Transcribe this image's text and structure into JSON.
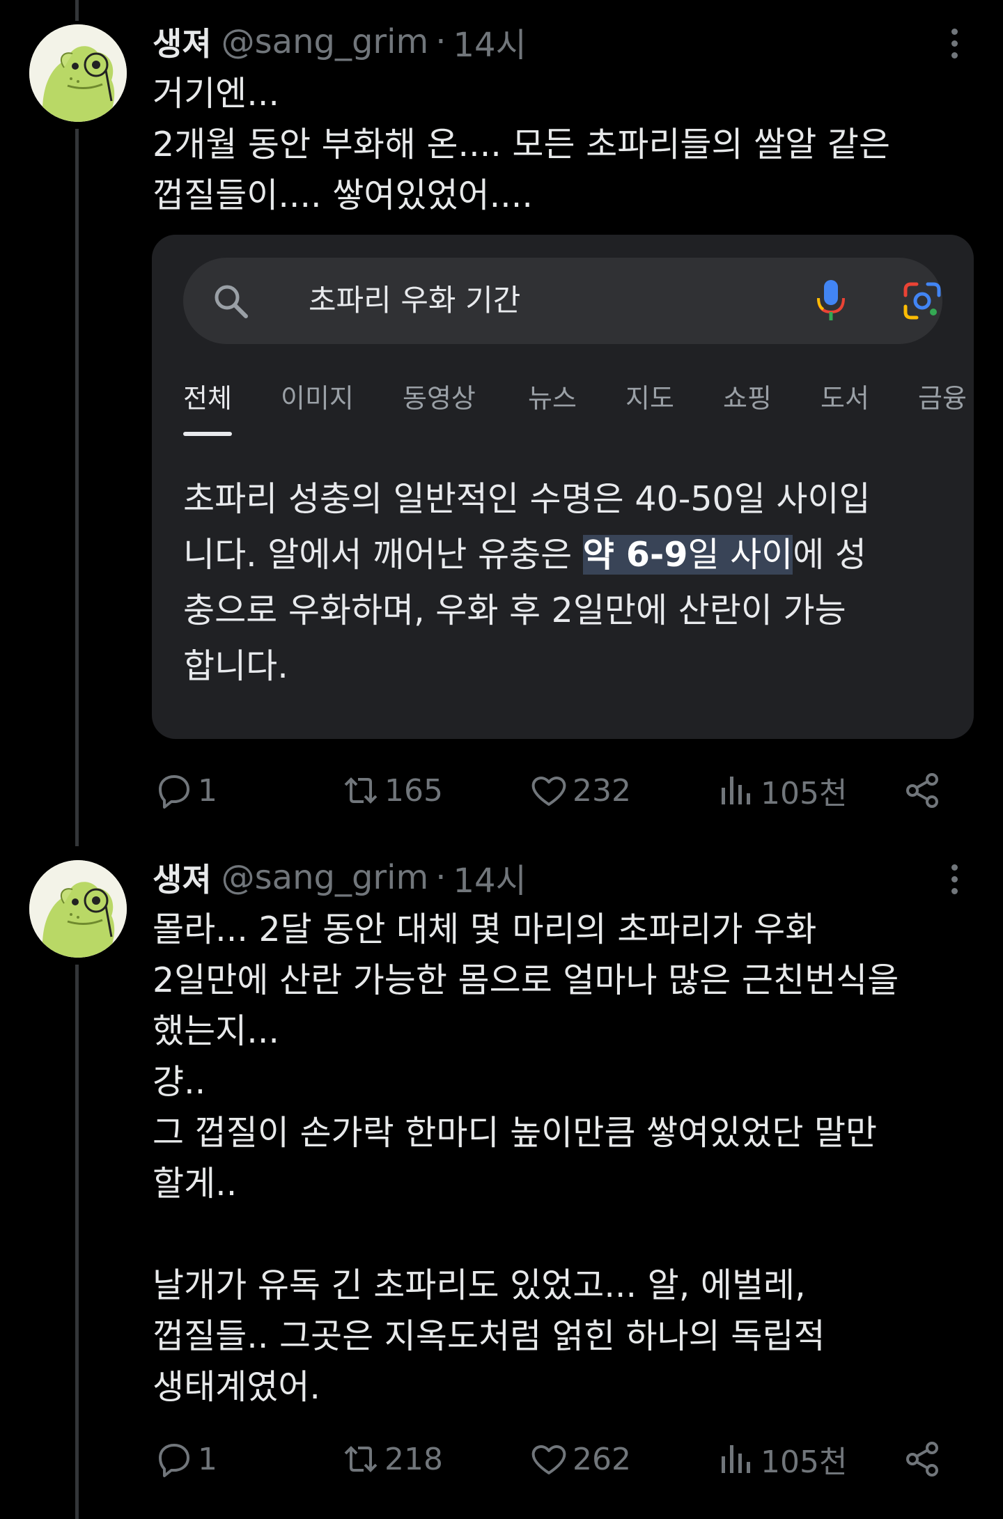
{
  "tweets": [
    {
      "display_name": "생져",
      "handle": "@sang_grim",
      "separator": "·",
      "time": "14시",
      "text_lines": [
        "거기엔...",
        "2개월 동안 부화해 온.... 모든 초파리들의 쌀알 같은",
        "껍질들이.... 쌓여있었어...."
      ],
      "stats": {
        "replies": "1",
        "retweets": "165",
        "likes": "232",
        "views": "105천"
      }
    },
    {
      "display_name": "생져",
      "handle": "@sang_grim",
      "separator": "·",
      "time": "14시",
      "text_lines": [
        "몰라... 2달 동안 대체 몇 마리의 초파리가 우화",
        "2일만에 산란 가능한 몸으로 얼마나 많은 근친번식을",
        "했는지...",
        "걍..",
        "그 껍질이 손가락 한마디 높이만큼 쌓여있었단 말만",
        "할게..",
        "",
        "날개가 유독 긴 초파리도 있었고... 알, 에벌레,",
        "껍질들.. 그곳은 지옥도처럼 얽힌 하나의 독립적",
        "생태계였어."
      ],
      "stats": {
        "replies": "1",
        "retweets": "218",
        "likes": "262",
        "views": "105천"
      }
    }
  ],
  "search_card": {
    "query": "초파리 우화 기간",
    "tabs": [
      "전체",
      "이미지",
      "동영상",
      "뉴스",
      "지도",
      "쇼핑",
      "도서",
      "금융"
    ],
    "active_tab": "전체",
    "result": {
      "line1": "초파리 성충의 일반적인 수명은 40-50일 사이입",
      "line2_before": "니다. 알에서 깨어난 유충은 ",
      "line2_highlight_bold": "약 6-9",
      "line2_highlight_rest": "일 사이",
      "line2_after": "에 성",
      "line3": "충으로 우화하며, 우화 후 2일만에 산란이 가능",
      "line4": "합니다."
    }
  },
  "colors": {
    "background": "#000000",
    "text": "#e7e9ea",
    "muted": "#71767b",
    "card": "#202124",
    "highlight": "#394457"
  },
  "icons": [
    "more-icon",
    "search-icon",
    "mic-icon",
    "google-lens-icon",
    "reply-icon",
    "retweet-icon",
    "like-icon",
    "views-icon",
    "share-icon"
  ]
}
